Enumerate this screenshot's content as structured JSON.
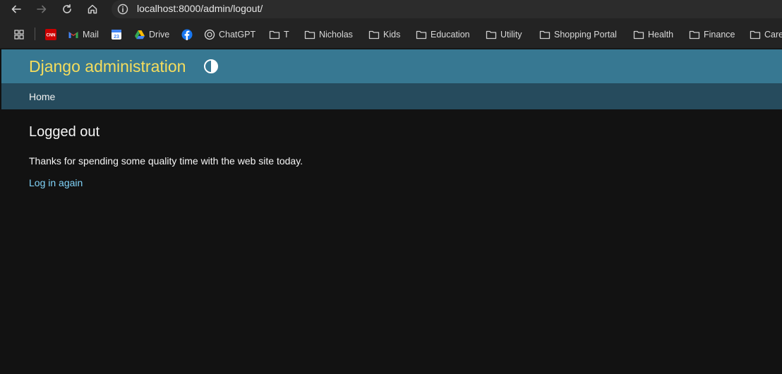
{
  "browser": {
    "url": "localhost:8000/admin/logout/",
    "bookmarks": [
      {
        "label": "",
        "icon": "cnn-icon"
      },
      {
        "label": "Mail",
        "icon": "gmail-icon"
      },
      {
        "label": "",
        "icon": "calendar-icon"
      },
      {
        "label": "Drive",
        "icon": "drive-icon"
      },
      {
        "label": "",
        "icon": "facebook-icon"
      },
      {
        "label": "ChatGPT",
        "icon": "chatgpt-icon"
      },
      {
        "label": "T",
        "icon": "folder-icon"
      },
      {
        "label": "Nicholas",
        "icon": "folder-icon"
      },
      {
        "label": "Kids",
        "icon": "folder-icon"
      },
      {
        "label": "Education",
        "icon": "folder-icon"
      },
      {
        "label": "Utility",
        "icon": "folder-icon"
      },
      {
        "label": "Shopping Portal",
        "icon": "folder-icon"
      },
      {
        "label": "Health",
        "icon": "folder-icon"
      },
      {
        "label": "Finance",
        "icon": "folder-icon"
      },
      {
        "label": "Care",
        "icon": "folder-icon"
      }
    ],
    "calendar_day": "23",
    "cnn_text": "CNN"
  },
  "header": {
    "title": "Django administration"
  },
  "breadcrumbs": {
    "home": "Home"
  },
  "main": {
    "title": "Logged out",
    "message": "Thanks for spending some quality time with the web site today.",
    "login_again": "Log in again"
  },
  "colors": {
    "header_bg": "#377892",
    "breadcrumbs_bg": "#264b5d",
    "title_color": "#f5dd5d",
    "link_color": "#81d4fa",
    "page_bg": "#121212"
  }
}
